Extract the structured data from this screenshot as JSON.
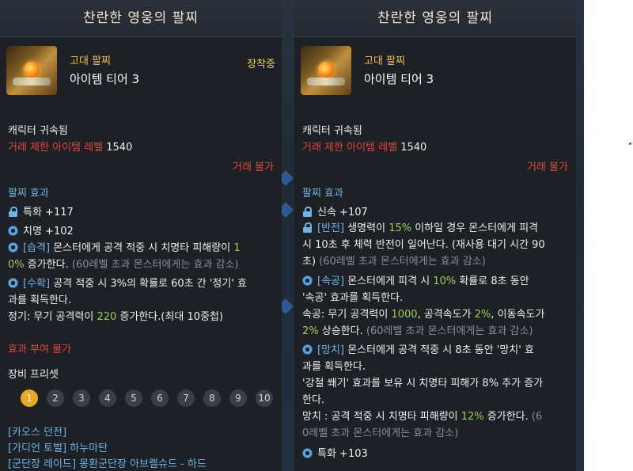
{
  "left": {
    "title": "찬란한 영웅의 팔찌",
    "grade": "고대 팔찌",
    "tier": "아이템 티어 3",
    "equipped": "장착중",
    "bound": "캐릭터 귀속됨",
    "trade_level_label": "거래 제한 아이템 레벨",
    "trade_level_value": "1540",
    "trade_no": "거래 불가",
    "effect_title": "팔찌 효과",
    "stat1": "특화 +117",
    "stat2": "치명 +102",
    "eff1_tag": "[습격]",
    "eff1_text1": " 몬스터에게 공격 적중 시 치명타 피해량이 ",
    "eff1_val": "1",
    "eff1_val2": "0%",
    "eff1_text2": " 증가한다. ",
    "eff1_note": "(60레벨 초과 몬스터에게는 효과 감소)",
    "eff2_tag": "[수확]",
    "eff2_text1": " 공격 적중 시 3%의 확률로 60초 간 '정기' 효",
    "eff2_text2": "과를 획득한다.",
    "eff2_text3": "정기: 무기 공격력이 ",
    "eff2_val": "220",
    "eff2_text4": " 증가한다.(최대 10중첩)",
    "no_grant": "효과 부여 불가",
    "preset_title": "장비 프리셋",
    "presets": [
      "1",
      "2",
      "3",
      "4",
      "5",
      "6",
      "7",
      "8",
      "9",
      "10"
    ],
    "content1": "[카오스 던전]",
    "content2": "[가디언 토벌] 하누마탄",
    "content3": "[군단장 레이드] 몽환군단장 아브렐슈드 - 하드"
  },
  "right": {
    "title": "찬란한 영웅의 팔찌",
    "grade": "고대 팔찌",
    "tier": "아이템 티어 3",
    "bound": "캐릭터 귀속됨",
    "trade_level_label": "거래 제한 아이템 레벨",
    "trade_level_value": "1540",
    "trade_no": "거래 불가",
    "effect_title": "팔찌 효과",
    "stat1": "신속 +107",
    "eff1_tag": "[반전]",
    "eff1_a": " 생명력이 ",
    "eff1_val": "15%",
    "eff1_b": " 이하일 경우 몬스터에게 피격",
    "eff1_c": "시 10초 후 체력 반전이 일어난다. (재사용 대기 시간 90",
    "eff1_d": "초) ",
    "eff1_note": "(60레벨 초과 몬스터에게는 효과 감소)",
    "eff2_tag": "[속공]",
    "eff2_a": " 몬스터에게 피격 시 ",
    "eff2_val": "10%",
    "eff2_b": " 확률로 8초 동안",
    "eff2_c": "'속공' 효과를 획득한다.",
    "eff2_d": "속공: 무기 공격력이 ",
    "eff2_val2": "1000",
    "eff2_e": ", 공격속도가 ",
    "eff2_val3": "2%",
    "eff2_f": ", 이동속도가",
    "eff2_val4": "2%",
    "eff2_g": " 상승한다. ",
    "eff2_note": "(60레벨 초과 몬스터에게는 효과 감소)",
    "eff3_tag": "[망치]",
    "eff3_a": " 몬스터에게 공격 적중 시 8초 동안 '망치' 효",
    "eff3_b": "과를 획득한다.",
    "eff3_c": "'강철 쐐기' 효과를 보유 시 치명타 피해가 8% 추가 증가",
    "eff3_d": "한다.",
    "eff3_e": "망치 : 공격 적중 시 치명타 피해량이 ",
    "eff3_val": "12%",
    "eff3_f": " 증가한다. ",
    "eff3_note1": "(6",
    "eff3_note2": "0레벨 초과 몬스터에게는 효과 감소)",
    "stat2": "특화 +103"
  },
  "colors": {
    "panel": "#1d2024",
    "red": "#e0473a",
    "blue": "#6fb4e6",
    "green": "#9bd05b",
    "gold": "#f0c04a"
  }
}
